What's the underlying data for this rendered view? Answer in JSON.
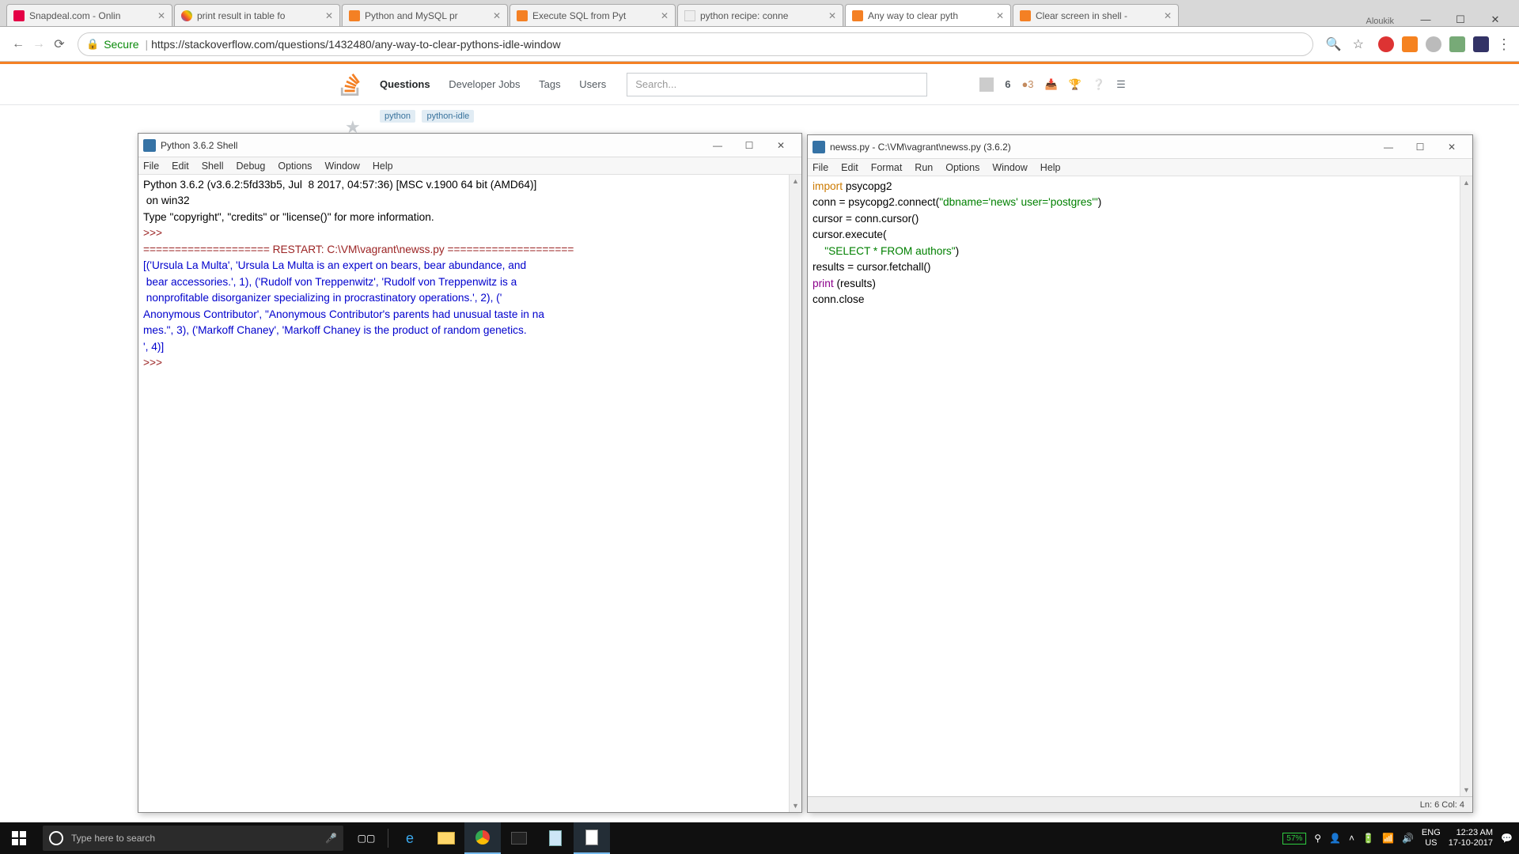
{
  "chrome": {
    "tabs": [
      {
        "title": "Snapdeal.com - Onlin"
      },
      {
        "title": "print result in table fo"
      },
      {
        "title": "Python and MySQL pr"
      },
      {
        "title": "Execute SQL from Pyt"
      },
      {
        "title": "python recipe: conne"
      },
      {
        "title": "Any way to clear pyth"
      },
      {
        "title": "Clear screen in shell -"
      }
    ],
    "user_label": "Aloukik",
    "secure_label": "Secure",
    "url": "https://stackoverflow.com/questions/1432480/any-way-to-clear-pythons-idle-window"
  },
  "so": {
    "nav": {
      "questions": "Questions",
      "jobs": "Developer Jobs",
      "tags": "Tags",
      "users": "Users"
    },
    "search_placeholder": "Search...",
    "rep": "6",
    "bronze": "●3",
    "tags": {
      "python": "python",
      "idle": "python-idle"
    }
  },
  "shell_window": {
    "title": "Python 3.6.2 Shell",
    "menu": {
      "file": "File",
      "edit": "Edit",
      "shell": "Shell",
      "debug": "Debug",
      "options": "Options",
      "window": "Window",
      "help": "Help"
    },
    "line1": "Python 3.6.2 (v3.6.2:5fd33b5, Jul  8 2017, 04:57:36) [MSC v.1900 64 bit (AMD64)]",
    "line2": " on win32",
    "line3": "Type \"copyright\", \"credits\" or \"license()\" for more information.",
    "prompt": ">>> ",
    "restart": "==================== RESTART: C:\\VM\\vagrant\\newss.py ====================",
    "out1": "[('Ursula La Multa', 'Ursula La Multa is an expert on bears, bear abundance, and",
    "out2": " bear accessories.', 1), ('Rudolf von Treppenwitz', 'Rudolf von Treppenwitz is a",
    "out3": " nonprofitable disorganizer specializing in procrastinatory operations.', 2), ('",
    "out4": "Anonymous Contributor', \"Anonymous Contributor's parents had unusual taste in na",
    "out5": "mes.\", 3), ('Markoff Chaney', 'Markoff Chaney is the product of random genetics.",
    "out6": "', 4)]"
  },
  "editor_window": {
    "title": "newss.py - C:\\VM\\vagrant\\newss.py (3.6.2)",
    "menu": {
      "file": "File",
      "edit": "Edit",
      "format": "Format",
      "run": "Run",
      "options": "Options",
      "window": "Window",
      "help": "Help"
    },
    "code": {
      "l1a": "import",
      "l1b": " psycopg2",
      "l2a": "conn = psycopg2.connect(",
      "l2b": "\"dbname='news' user='postgres'\"",
      "l2c": ")",
      "l3": "cursor = conn.cursor()",
      "l4": "cursor.execute(",
      "l5a": "    ",
      "l5b": "\"SELECT * FROM authors\"",
      "l5c": ")",
      "l6": "results = cursor.fetchall()",
      "l7a": "print",
      "l7b": " (results)",
      "l8": "conn.close"
    },
    "status": "Ln: 6   Col: 4"
  },
  "taskbar": {
    "search_placeholder": "Type here to search",
    "battery": "57%",
    "lang1": "ENG",
    "lang2": "US",
    "time": "12:23 AM",
    "date": "17-10-2017"
  }
}
